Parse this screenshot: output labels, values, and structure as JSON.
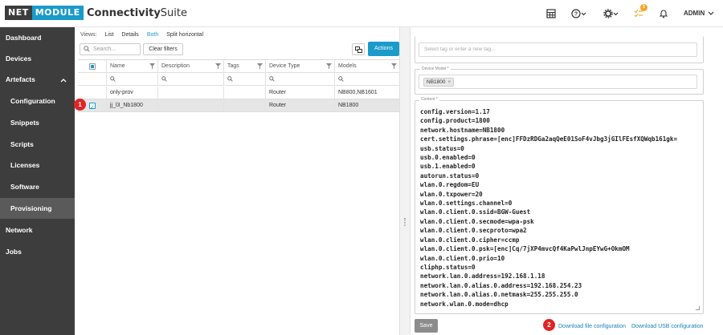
{
  "header": {
    "logo_left": "NET",
    "logo_right": "MODULE",
    "title_bold": "Connectivity",
    "title_light": "Suite",
    "notification_count": "1",
    "user": "ADMIN"
  },
  "sidebar": {
    "items": [
      {
        "label": "Dashboard"
      },
      {
        "label": "Devices"
      },
      {
        "label": "Artefacts"
      },
      {
        "label": "Configuration"
      },
      {
        "label": "Snippets"
      },
      {
        "label": "Scripts"
      },
      {
        "label": "Licenses"
      },
      {
        "label": "Software"
      },
      {
        "label": "Provisioning"
      },
      {
        "label": "Network"
      },
      {
        "label": "Jobs"
      }
    ],
    "active": "Provisioning"
  },
  "toolbar": {
    "views_label": "Views:",
    "views": [
      "List",
      "Details",
      "Both",
      "Split horizontal"
    ],
    "active_view": "Both",
    "search_placeholder": "Search...",
    "clear_filters": "Clear filters",
    "actions": "Actions"
  },
  "table": {
    "columns": [
      "Name",
      "Description",
      "Tags",
      "Device Type",
      "Models"
    ],
    "rows": [
      {
        "name": "only-prov",
        "description": "",
        "tags": "",
        "device_type": "Router",
        "models": "NB800,NB1601",
        "selected": false
      },
      {
        "name": "jj_l3_Nb1800",
        "description": "",
        "tags": "",
        "device_type": "Router",
        "models": "NB1800",
        "selected": true
      }
    ]
  },
  "markers": [
    "1",
    "2"
  ],
  "details": {
    "tag_placeholder": "Select tag or enter a new tag...",
    "device_model_label": "Device Model *",
    "device_model_chip": "NB1800",
    "content_label": "Content *",
    "content_lines": [
      "config.version=1.17",
      "config.product=1800",
      "network.hostname=NB1800",
      "cert.settings.phrase=[enc]FFDzRDGa2aqQeE01SoF4vJbg3jGIlFEsfXQWqb161gk=",
      "usb.status=0",
      "usb.0.enabled=0",
      "usb.1.enabled=0",
      "autorun.status=0",
      "wlan.0.regdom=EU",
      "wlan.0.txpower=20",
      "wlan.0.settings.channel=0",
      "wlan.0.client.0.ssid=BGW-Guest",
      "wlan.0.client.0.secmode=wpa-psk",
      "wlan.0.client.0.secproto=wpa2",
      "wlan.0.client.0.cipher=ccmp",
      "wlan.0.client.0.psk=[enc]Cq/7jXP4mvcQf4KaPwlJnpEYwG+OkmOM",
      "wlan.0.client.0.prio=10",
      "cliphp.status=0",
      "network.lan.0.address=192.168.1.18",
      "network.lan.0.alias.0.address=192.168.254.23",
      "network.lan.0.alias.0.netmask=255.255.255.0",
      "network.wlan.0.mode=dhcp"
    ],
    "save": "Save",
    "download_file": "Download file configuration",
    "download_usb": "Download USB configuration"
  },
  "colors": {
    "accent": "#1a9bc9",
    "sidebar_bg": "#3d3d3d",
    "marker": "#e02424"
  }
}
